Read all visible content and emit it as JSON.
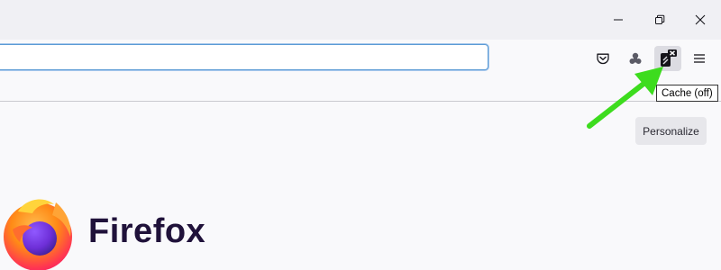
{
  "window": {
    "controls": {
      "minimize_icon": "minimize-icon",
      "restore_icon": "restore-icon",
      "close_icon": "close-icon"
    }
  },
  "toolbar": {
    "url_value": "",
    "buttons": [
      {
        "icon": "pocket-icon"
      },
      {
        "icon": "extension-icon"
      },
      {
        "icon": "cache-off-icon"
      },
      {
        "icon": "hamburger-menu-icon"
      }
    ],
    "tooltip": "Cache (off)"
  },
  "newtab": {
    "personalize_label": "Personalize",
    "brand_name": "Firefox"
  },
  "colors": {
    "titlebar_bg": "#f0f0f4",
    "toolbar_bg": "#f9f9fb",
    "urlbar_focus": "#5b9bd5",
    "annotation_arrow": "#3ddc1e",
    "brand_text": "#20123a"
  }
}
